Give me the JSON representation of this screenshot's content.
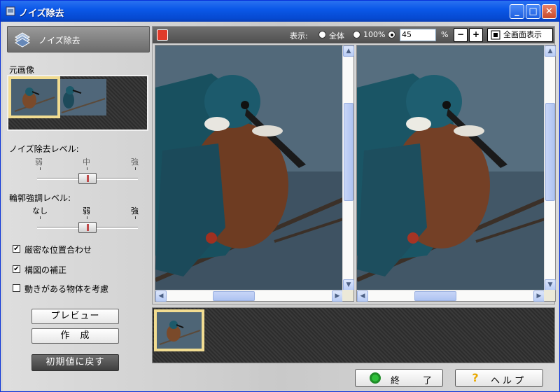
{
  "window": {
    "title": "ノイズ除去",
    "minimize": "_",
    "maximize": "□",
    "close": "✕"
  },
  "left": {
    "header_label": "ノイズ除去",
    "source_label": "元画像",
    "noise_level": {
      "label": "ノイズ除去レベル:",
      "scale": [
        "弱",
        "中",
        "強"
      ],
      "value": "中"
    },
    "edge_level": {
      "label": "輪郭強調レベル:",
      "scale": [
        "なし",
        "弱",
        "強"
      ],
      "value": "弱"
    },
    "checks": [
      {
        "label": "厳密な位置合わせ",
        "checked": true
      },
      {
        "label": "構図の補正",
        "checked": true
      },
      {
        "label": "動きがある物体を考慮",
        "checked": false
      }
    ],
    "preview_button": "プレビュー",
    "create_button": "作　成",
    "reset_button": "初期値に戻す"
  },
  "toolbar": {
    "display_label": "表示:",
    "options": [
      "全体",
      "100%"
    ],
    "selected": "custom",
    "zoom_value": "45",
    "percent": "%",
    "zoom_out": "−",
    "zoom_in": "+",
    "fullscreen_label": "全画面表示"
  },
  "footer": {
    "exit_button": "終　了",
    "help_button": "ヘルプ"
  },
  "icons": [
    "app-icon",
    "stack-icon",
    "hand-icon",
    "zoom-out-icon",
    "zoom-in-icon",
    "fullscreen-icon",
    "exit-icon",
    "help-icon"
  ]
}
